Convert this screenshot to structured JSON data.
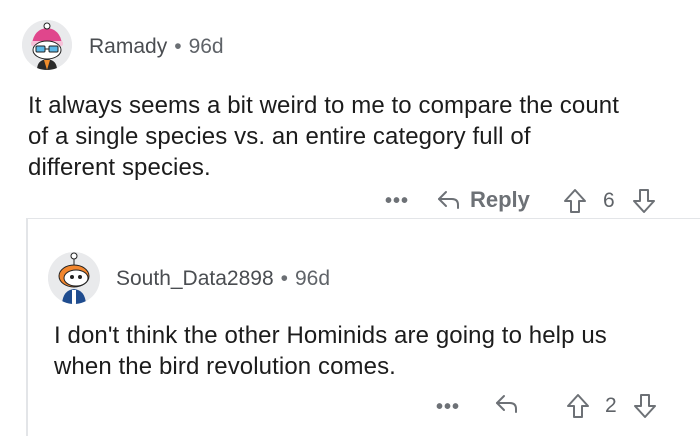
{
  "comments": [
    {
      "author": "Ramady",
      "age": "96d",
      "text_lines": [
        "It always seems a bit weird to me to compare the count",
        "of a single species vs. an entire category full of",
        "different species."
      ],
      "more": "•••",
      "reply_label": "Reply",
      "score": "6"
    },
    {
      "author": "South_Data2898",
      "age": "96d",
      "text_lines": [
        "I don't think the other Hominids are going to help us",
        "when the bird revolution comes."
      ],
      "more": "•••",
      "score": "2"
    }
  ],
  "separator": "•",
  "icons": {
    "more": "ellipsis-icon",
    "reply": "reply-arrow-icon",
    "upvote": "upvote-arrow-icon",
    "downvote": "downvote-arrow-icon"
  },
  "colors": {
    "text": "#1c1c1c",
    "meta": "#5f6368",
    "icon": "#6d7176",
    "divider": "#e3e5e8"
  }
}
